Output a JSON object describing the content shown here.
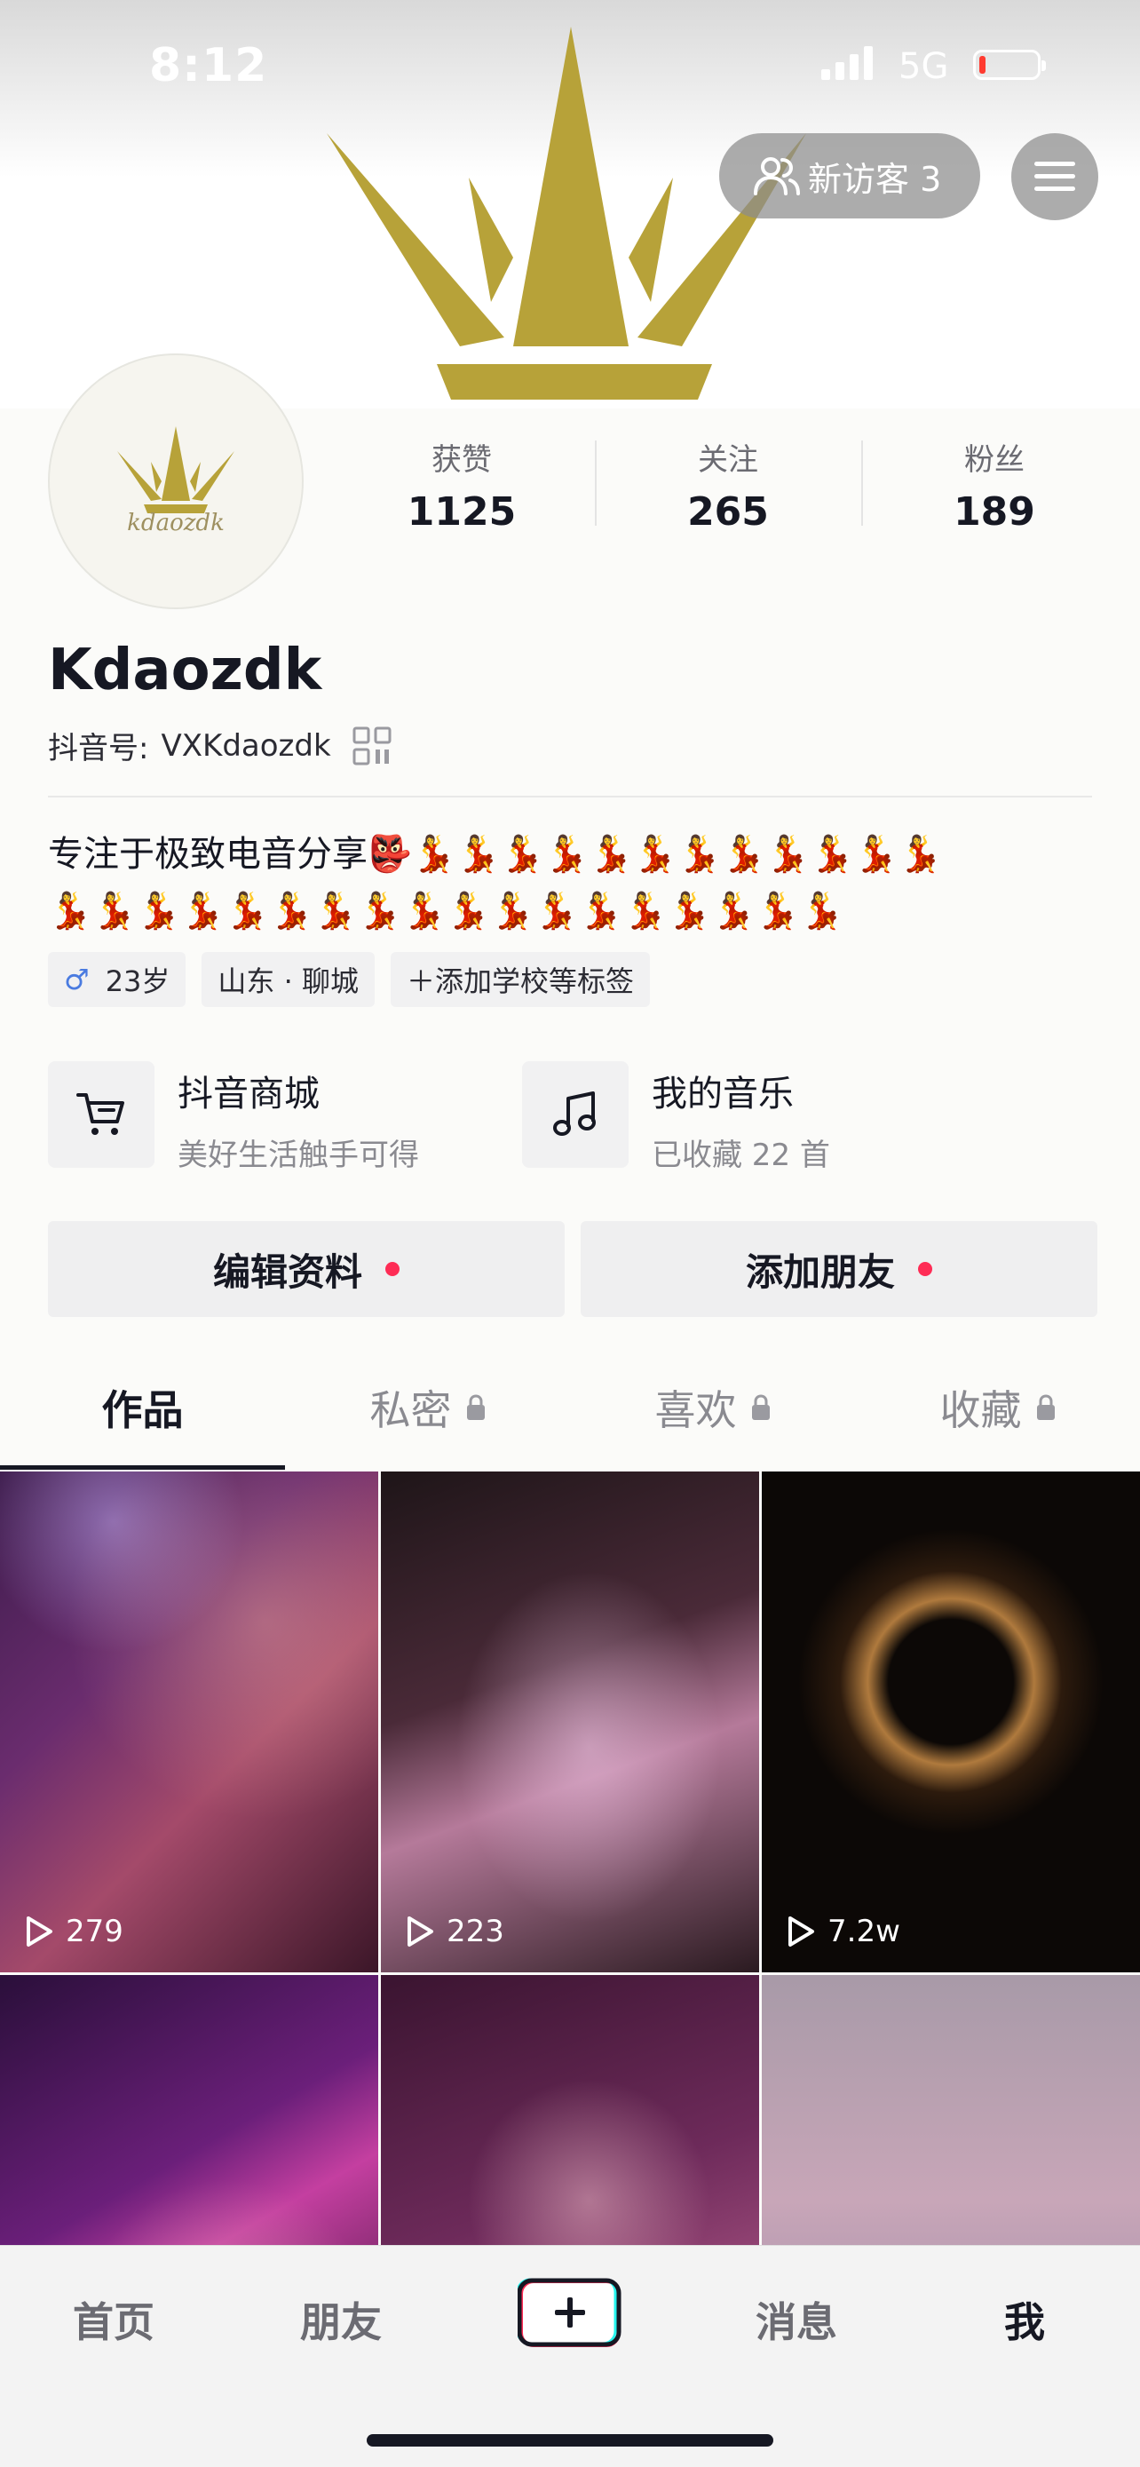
{
  "status_bar": {
    "time": "8:12",
    "network": "5G"
  },
  "header": {
    "visitor_label": "新访客 3",
    "colors": {
      "crown": "#b7a239"
    }
  },
  "profile": {
    "name": "Kdaozdk",
    "douyin_id_label": "抖音号:",
    "douyin_id_value": "VXKdaozdk",
    "avatar_text": "kdaozdk",
    "stats": [
      {
        "label": "获赞",
        "value": "1125"
      },
      {
        "label": "关注",
        "value": "265"
      },
      {
        "label": "粉丝",
        "value": "189"
      }
    ],
    "bio_text": "专注于极致电音分享",
    "bio_emoji_mask": "👺",
    "bio_emoji_row1": "💃💃💃💃💃💃💃💃💃💃💃💃",
    "bio_emoji_row2": "💃💃💃💃💃💃💃💃💃💃💃💃💃💃💃💃💃💃",
    "tags": {
      "gender_symbol": "♂",
      "age": "23岁",
      "location": "山东 · 聊城",
      "add_tag": "＋添加学校等标签"
    }
  },
  "features": {
    "shop": {
      "title": "抖音商城",
      "subtitle": "美好生活触手可得",
      "icon": "cart-icon"
    },
    "music": {
      "title": "我的音乐",
      "subtitle": "已收藏 22 首",
      "icon": "music-note-icon"
    }
  },
  "actions": {
    "edit_profile": "编辑资料",
    "add_friend": "添加朋友"
  },
  "tabs": [
    {
      "label": "作品",
      "locked": false
    },
    {
      "label": "私密",
      "locked": true
    },
    {
      "label": "喜欢",
      "locked": true
    },
    {
      "label": "收藏",
      "locked": true
    }
  ],
  "videos": [
    {
      "plays": "279"
    },
    {
      "plays": "223"
    },
    {
      "plays": "7.2w"
    },
    {
      "plays": ""
    },
    {
      "plays": ""
    },
    {
      "plays": ""
    }
  ],
  "bottom_nav": {
    "home": "首页",
    "friends": "朋友",
    "messages": "消息",
    "me": "我"
  }
}
